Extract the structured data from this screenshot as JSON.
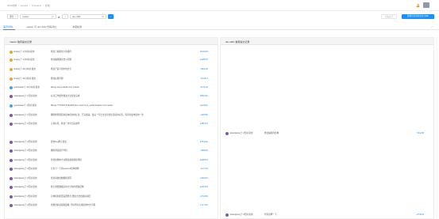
{
  "breadcrumb": [
    "HSS前端",
    "/",
    "aposta",
    "/",
    "Frontend",
    "/",
    "合规"
  ],
  "filters": {
    "left_select": "源分",
    "left_input": "master",
    "left_count": "27",
    "right_select": "目标",
    "right_input": "dev-3dfc",
    "right_count": "18",
    "search_icon": "search-icon",
    "ghost_button": "仅看差异",
    "primary_button": "预测可合并的分支 (MR)"
  },
  "tabs": [
    {
      "label": "差异详情",
      "active": true
    },
    {
      "label": "master 与 dev-3dfc 代码对比",
      "active": false
    },
    {
      "label": "冲突检测",
      "active": false
    }
  ],
  "left_panel": {
    "title": "master 独有提交记录",
    "rows": [
      {
        "who": "liuqing于 4小时前 提交",
        "msg": "修改了编辑台小的组件",
        "hash": "3bc6ab6",
        "color": "#e0a93a"
      },
      {
        "who": "liuqing于 4小时前 提交",
        "msg": "修改编辑图表台小问题",
        "hash": "2ad8576",
        "color": "#e0a93a"
      },
      {
        "who": "liuqing于 20小时前 提交",
        "msg": "修改产品介绍中的文字",
        "hash": "0f9be36",
        "color": "#e0a93a"
      },
      {
        "who": "liuqing于 20小时前 提交",
        "msg": "修改标题问题",
        "hash": "c3ca5c2",
        "color": "#e0a93a"
      },
      {
        "who": "guanluxiao于 22小时前 提交",
        "msg": "Merge test-code#ui into master",
        "hash": "44731ef",
        "color": "#4aa3df"
      },
      {
        "who": "wtaoqipeng于 1天前 提交",
        "msg": "标注工作组件修改大法优化完成",
        "hash": "5866c8e",
        "color": "#7b5aa6"
      },
      {
        "who": "guanluxiao于 1天前 提交",
        "msg": "Merge 777b2df..87ded84 from test-home_authentication into master",
        "hash": "aac9d3e",
        "color": "#4aa3df"
      },
      {
        "who": "wtaoqipeng于 1天前 提交",
        "msg": "删除检测流程在基本优化的标注，已完成来，最后一行点击显示优化选项的标签，等待的发布提交一次",
        "hash": "ad6f75b",
        "color": "#7b5aa6"
      },
      {
        "who": "wtaoqipeng于 1天前 提交",
        "msg": "正常标签，修改一次导出完成件",
        "hash": "ed8b7d7",
        "color": "#7b5aa6"
      },
      {
        "who": "wtaoqipeng于 2天前 提交",
        "msg": "提交bug修正提交",
        "hash": "87da64a",
        "color": "#7b5aa6"
      },
      {
        "who": "wtaoqipeng于 2天前 提交",
        "msg": "删除调试运行代码",
        "hash": "f4d8eb5",
        "color": "#7b5aa6"
      },
      {
        "who": "wtaoqipeng于 2天前 提交",
        "msg": "优化的整体大功能加载性能和测性",
        "hash": "3ad8279",
        "color": "#7b5aa6"
      },
      {
        "who": "wtaoqipeng于 2天前 提交",
        "msg": "分文下一下的systemd结构调整",
        "hash": "d1c737f",
        "color": "#7b5aa6"
      },
      {
        "who": "wtaoqipeng于 2天前 提交",
        "msg": "优化系统的数据和流程",
        "hash": "a165e8c",
        "color": "#7b5aa6"
      },
      {
        "who": "wtaoqipeng于 2天前 提交",
        "msg": "修正重要数据后的方分化的增加结构",
        "hash": "ae6b233",
        "color": "#7b5aa6"
      },
      {
        "who": "wtaoqipeng于 2天前 提交",
        "msg": "实体机的配置设置整合 增加大文档组织项目",
        "hash": "c272db6",
        "color": "#7b5aa6"
      },
      {
        "who": "wtaoqipeng于 2天前 提交",
        "msg": "新增的前者提取部署, 代码所有应用使用中文字典",
        "hash": "17e7dc2",
        "color": "#7b5aa6"
      }
    ]
  },
  "right_panel": {
    "title": "dev-3dfc 独有提交记录",
    "rows": [
      {
        "who": "wtaoqipeng于 2天前 提交",
        "msg": "修改编辑的结构",
        "hash": "72be26f",
        "color": "#7b5aa6"
      },
      {
        "who": "wtaoqipeng于 3天前 提交",
        "msg": "代码注释一下",
        "hash": "ef73be9",
        "color": "#7b5aa6"
      }
    ]
  }
}
